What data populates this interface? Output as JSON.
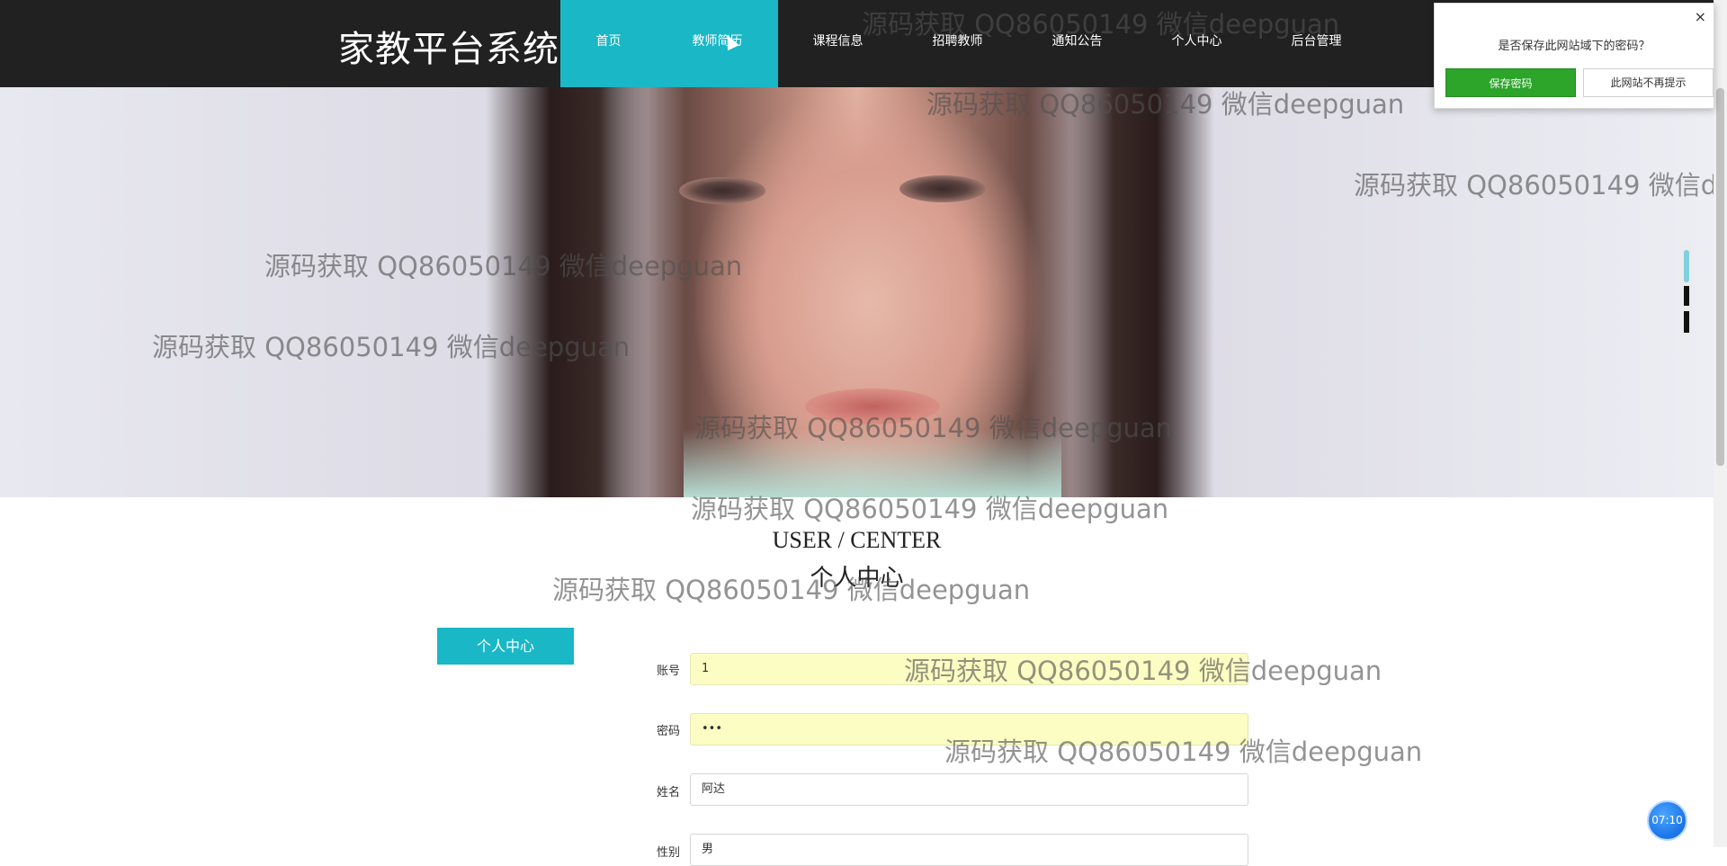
{
  "header": {
    "logo": "家教平台系统",
    "nav": [
      {
        "label": "首页",
        "active": true
      },
      {
        "label": "教师简历",
        "active": true
      },
      {
        "label": "课程信息",
        "active": false
      },
      {
        "label": "招聘教师",
        "active": false
      },
      {
        "label": "通知公告",
        "active": false
      },
      {
        "label": "个人中心",
        "active": false
      },
      {
        "label": "后台管理",
        "active": false
      }
    ]
  },
  "page_title": {
    "en": "USER / CENTER",
    "zh": "个人中心"
  },
  "sidebar": {
    "button_label": "个人中心"
  },
  "form": {
    "fields": [
      {
        "label": "账号",
        "value": "1"
      },
      {
        "label": "密码",
        "value": "•••"
      },
      {
        "label": "姓名",
        "value": "阿达"
      },
      {
        "label": "性别",
        "value": "男"
      }
    ]
  },
  "password_popup": {
    "question": "是否保存此网站域下的密码？",
    "save_label": "保存密码",
    "never_label": "此网站不再提示",
    "close_glyph": "×"
  },
  "timer": {
    "value": "07:10"
  },
  "watermark": {
    "text": "源码获取 QQ86050149 微信deepguan"
  },
  "colors": {
    "accent": "#1ab7c6",
    "header_bg": "#212121",
    "save_green": "#2ca52a",
    "autofill": "#fbfdc2"
  }
}
